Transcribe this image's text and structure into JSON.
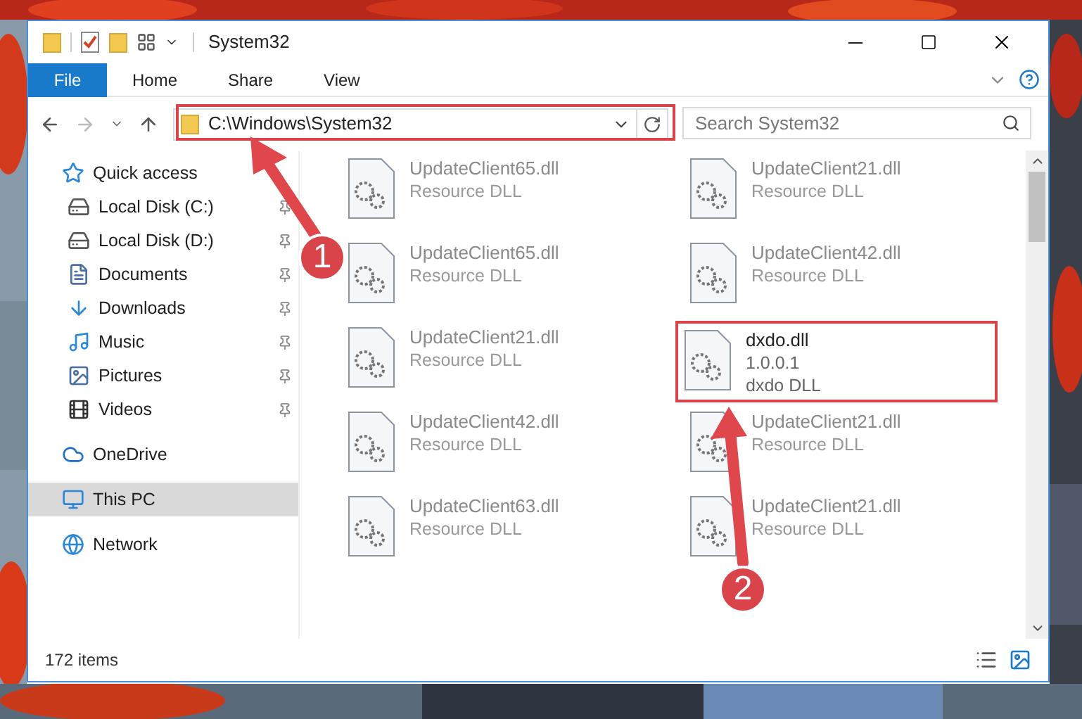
{
  "window": {
    "title": "System32"
  },
  "ribbon_tabs": [
    {
      "label": "File",
      "selected": true
    },
    {
      "label": "Home",
      "selected": false
    },
    {
      "label": "Share",
      "selected": false
    },
    {
      "label": "View",
      "selected": false
    }
  ],
  "address": {
    "path": "C:\\Windows\\System32"
  },
  "search": {
    "placeholder": "Search System32"
  },
  "sidebar": {
    "items": [
      {
        "label": "Quick access",
        "selected": false,
        "children": [
          {
            "label": "Local Disk (C:)",
            "pinned": true,
            "selected": false
          },
          {
            "label": "Local Disk (D:)",
            "pinned": true,
            "selected": false
          },
          {
            "label": "Documents",
            "pinned": true,
            "selected": false
          },
          {
            "label": "Downloads",
            "pinned": true,
            "selected": false
          },
          {
            "label": "Music",
            "pinned": true,
            "selected": false
          },
          {
            "label": "Pictures",
            "pinned": true,
            "selected": false
          },
          {
            "label": "Videos",
            "pinned": true,
            "selected": false
          }
        ]
      },
      {
        "label": "OneDrive",
        "selected": false
      },
      {
        "label": "This PC",
        "selected": true
      },
      {
        "label": "Network",
        "selected": false
      }
    ]
  },
  "files": [
    {
      "name": "UpdateClient65.dll",
      "lines": [
        "Resource DLL"
      ],
      "dimmed": true,
      "highlighted": false
    },
    {
      "name": "UpdateClient21.dll",
      "lines": [
        "Resource DLL"
      ],
      "dimmed": true,
      "highlighted": false
    },
    {
      "name": "UpdateClient65.dll",
      "lines": [
        "Resource DLL"
      ],
      "dimmed": true,
      "highlighted": false
    },
    {
      "name": "UpdateClient42.dll",
      "lines": [
        "Resource DLL"
      ],
      "dimmed": true,
      "highlighted": false
    },
    {
      "name": "UpdateClient21.dll",
      "lines": [
        "Resource DLL"
      ],
      "dimmed": true,
      "highlighted": false
    },
    {
      "name": "dxdo.dll",
      "lines": [
        "1.0.0.1",
        "dxdo DLL"
      ],
      "dimmed": false,
      "highlighted": true
    },
    {
      "name": "UpdateClient42.dll",
      "lines": [
        "Resource DLL"
      ],
      "dimmed": true,
      "highlighted": false
    },
    {
      "name": "UpdateClient21.dll",
      "lines": [
        "Resource DLL"
      ],
      "dimmed": true,
      "highlighted": false
    },
    {
      "name": "UpdateClient63.dll",
      "lines": [
        "Resource DLL"
      ],
      "dimmed": true,
      "highlighted": false
    },
    {
      "name": "UpdateClient21.dll",
      "lines": [
        "Resource DLL"
      ],
      "dimmed": true,
      "highlighted": false
    }
  ],
  "status_bar": {
    "item_count": "172 items"
  },
  "annotations": [
    {
      "label": "1"
    },
    {
      "label": "2"
    }
  ]
}
